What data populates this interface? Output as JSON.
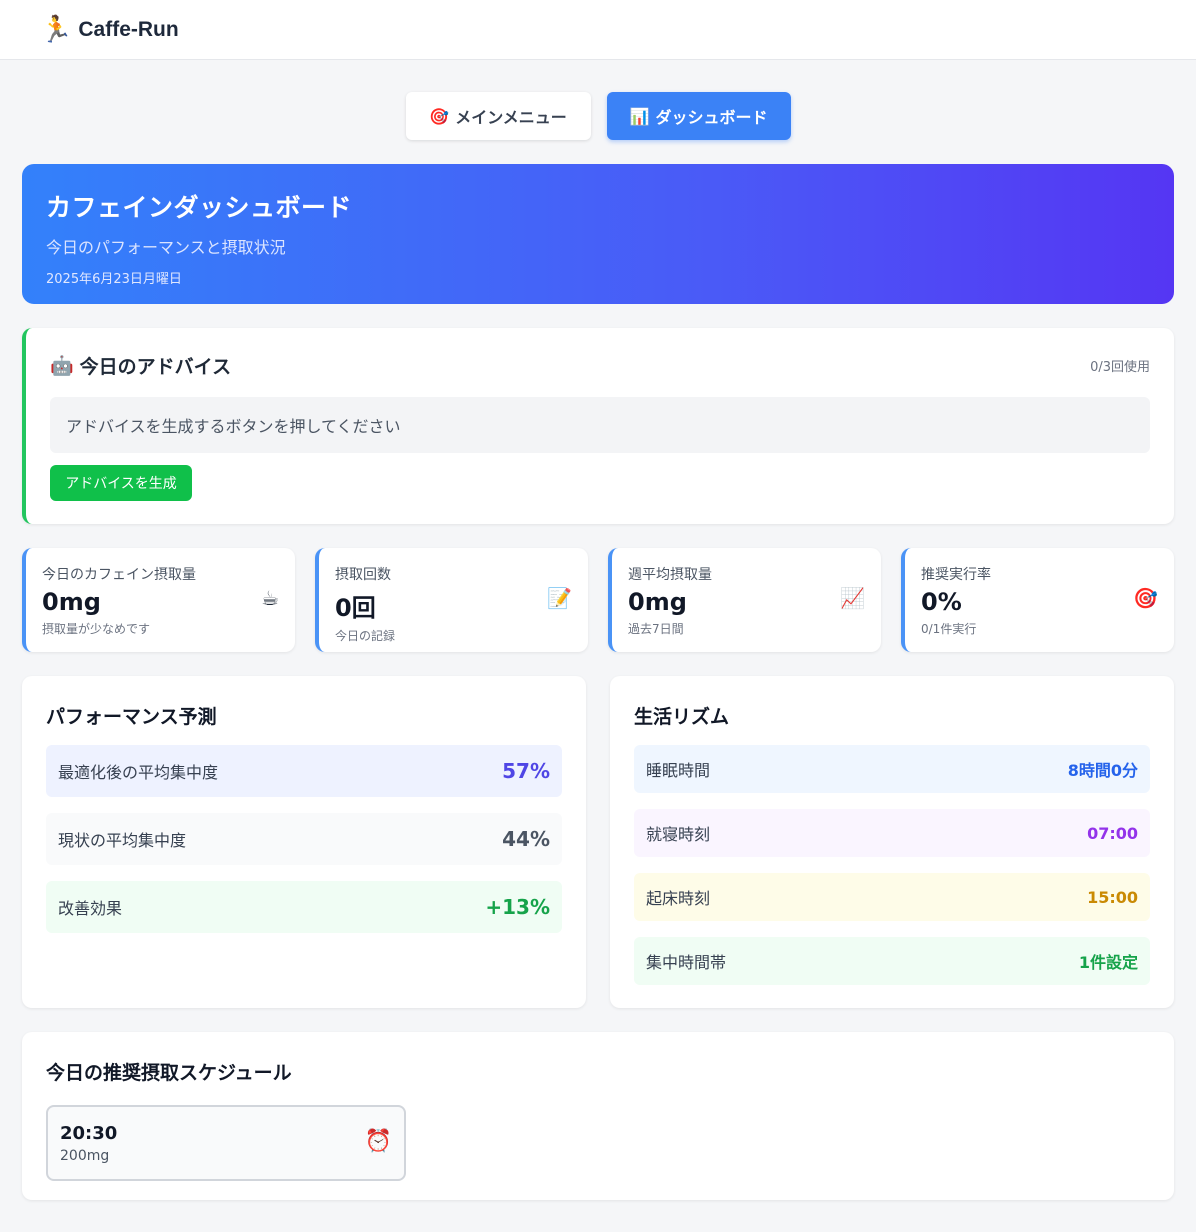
{
  "app": {
    "name": "Caffe-Run",
    "logo_icon": "running-person-icon",
    "logo_glyph": "🏃"
  },
  "nav": {
    "main_menu": {
      "icon": "🎯",
      "label": "メインメニュー"
    },
    "dashboard": {
      "icon": "📊",
      "label": "ダッシュボード"
    }
  },
  "hero": {
    "title": "カフェインダッシュボード",
    "subtitle": "今日のパフォーマンスと摂取状況",
    "date": "2025年6月23日月曜日"
  },
  "advice": {
    "icon": "🤖",
    "title": "今日のアドバイス",
    "usage": "0/3回使用",
    "message": "アドバイスを生成するボタンを押してください",
    "button_label": "アドバイスを生成"
  },
  "stats": [
    {
      "label": "今日のカフェイン摂取量",
      "value": "0mg",
      "note": "摂取量が少なめです",
      "icon": "☕"
    },
    {
      "label": "摂取回数",
      "value": "0回",
      "note": "今日の記録",
      "icon": "📝"
    },
    {
      "label": "週平均摂取量",
      "value": "0mg",
      "note": "過去7日間",
      "icon": "📈"
    },
    {
      "label": "推奨実行率",
      "value": "0%",
      "note": "0/1件実行",
      "icon": "🎯"
    }
  ],
  "performance": {
    "title": "パフォーマンス予測",
    "rows": [
      {
        "label": "最適化後の平均集中度",
        "value": "57%",
        "bg": "#eef2ff",
        "color": "#4f46e5"
      },
      {
        "label": "現状の平均集中度",
        "value": "44%",
        "bg": "#f9fafb",
        "color": "#4b5563"
      },
      {
        "label": "改善効果",
        "value": "+13%",
        "bg": "#f0fdf4",
        "color": "#16a34a"
      }
    ]
  },
  "rhythm": {
    "title": "生活リズム",
    "rows": [
      {
        "label": "睡眠時間",
        "value": "8時間0分",
        "bg": "#eff6ff",
        "color": "#2563eb"
      },
      {
        "label": "就寝時刻",
        "value": "07:00",
        "bg": "#faf5ff",
        "color": "#9333ea"
      },
      {
        "label": "起床時刻",
        "value": "15:00",
        "bg": "#fefce8",
        "color": "#ca8a04"
      },
      {
        "label": "集中時間帯",
        "value": "1件設定",
        "bg": "#f0fdf4",
        "color": "#16a34a"
      }
    ]
  },
  "schedule": {
    "title": "今日の推奨摂取スケジュール",
    "items": [
      {
        "time": "20:30",
        "amount": "200mg",
        "icon": "⏰"
      }
    ]
  }
}
